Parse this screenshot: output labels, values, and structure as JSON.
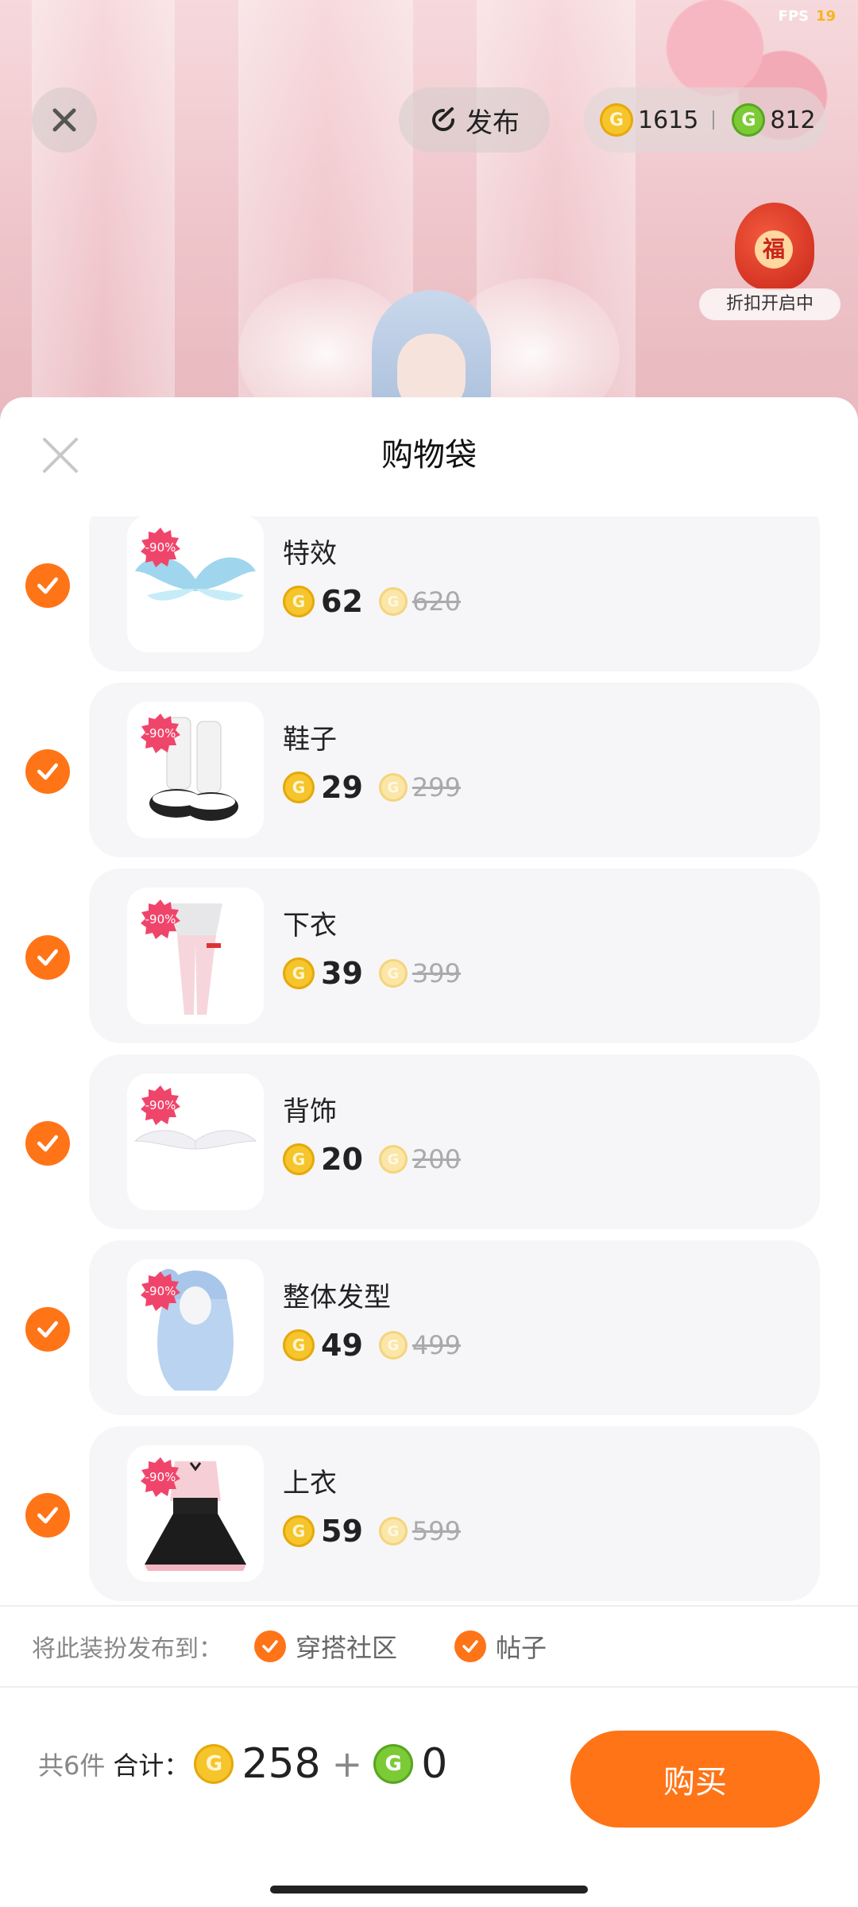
{
  "status": {
    "fps_label": "FPS",
    "fps_value": "19"
  },
  "topbar": {
    "publish_label": "发布",
    "gold_balance": "1615",
    "green_balance": "812",
    "promo_label": "折扣开启中",
    "promo_glyph": "福"
  },
  "sheet": {
    "title": "购物袋"
  },
  "items": [
    {
      "name": "特效",
      "discount": "-90%",
      "price": "62",
      "original": "620",
      "checked": true
    },
    {
      "name": "鞋子",
      "discount": "-90%",
      "price": "29",
      "original": "299",
      "checked": true
    },
    {
      "name": "下衣",
      "discount": "-90%",
      "price": "39",
      "original": "399",
      "checked": true
    },
    {
      "name": "背饰",
      "discount": "-90%",
      "price": "20",
      "original": "200",
      "checked": true
    },
    {
      "name": "整体发型",
      "discount": "-90%",
      "price": "49",
      "original": "499",
      "checked": true
    },
    {
      "name": "上衣",
      "discount": "-90%",
      "price": "59",
      "original": "599",
      "checked": true
    }
  ],
  "share": {
    "label": "将此装扮发布到：",
    "options": [
      {
        "label": "穿搭社区",
        "checked": true
      },
      {
        "label": "帖子",
        "checked": true
      }
    ]
  },
  "footer": {
    "count": "共6件",
    "sum_label": "合计：",
    "gold_total": "258",
    "plus": "+",
    "green_total": "0",
    "buy_label": "购买"
  },
  "colors": {
    "accent": "#ff7417",
    "gold_coin": "#f6c42b",
    "green_coin": "#7ccb36",
    "badge": "#f0456b"
  }
}
